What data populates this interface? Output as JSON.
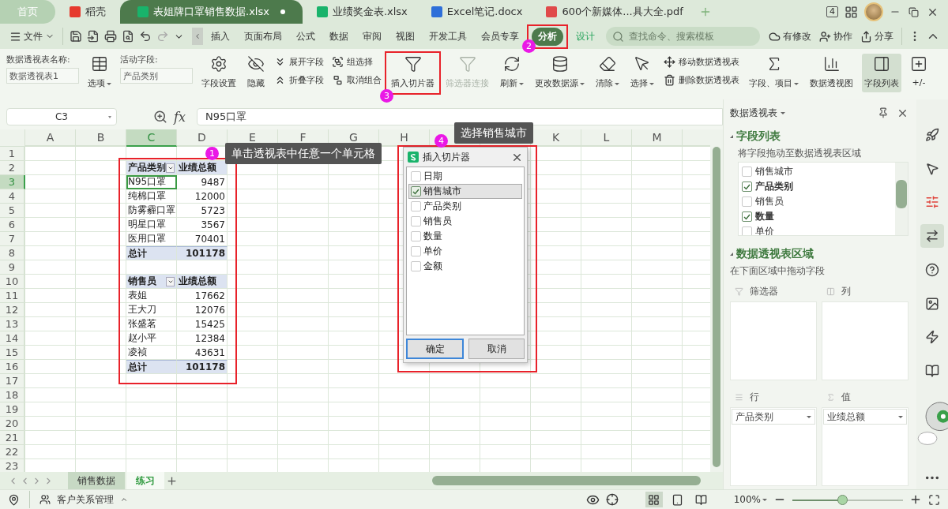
{
  "app_tabs": [
    {
      "label": "首页",
      "kind": "home",
      "selected": false
    },
    {
      "label": "稻壳",
      "kind": "docer",
      "selected": false
    },
    {
      "label": "表姐牌口罩销售数据.xlsx",
      "kind": "sheet",
      "selected": true
    },
    {
      "label": "业绩奖金表.xlsx",
      "kind": "sheet",
      "selected": false
    },
    {
      "label": "Excel笔记.docx",
      "kind": "doc",
      "selected": false
    },
    {
      "label": "600个新媒体...具大全.pdf",
      "kind": "pdf",
      "selected": false
    }
  ],
  "device_badge": "4",
  "menu": {
    "file": "文件",
    "items": [
      {
        "label": "插入",
        "kind": "normal",
        "selected": false
      },
      {
        "label": "页面布局",
        "kind": "normal",
        "selected": false
      },
      {
        "label": "公式",
        "kind": "normal",
        "selected": false
      },
      {
        "label": "数据",
        "kind": "normal",
        "selected": false
      },
      {
        "label": "审阅",
        "kind": "normal",
        "selected": false
      },
      {
        "label": "视图",
        "kind": "normal",
        "selected": false
      },
      {
        "label": "开发工具",
        "kind": "normal",
        "selected": false
      },
      {
        "label": "会员专享",
        "kind": "normal",
        "selected": false
      },
      {
        "label": "分析",
        "kind": "context",
        "selected": true
      },
      {
        "label": "设计",
        "kind": "context",
        "selected": false
      }
    ],
    "search": {
      "placeholder": "查找命令、搜索模板"
    },
    "actions": [
      "有修改",
      "协作",
      "分享"
    ]
  },
  "ribbon": [
    {
      "kind": "field",
      "label": "数据透视表名称:",
      "value": "数据透视表1"
    },
    {
      "kind": "large",
      "label": "选项",
      "dropdown": true,
      "disabled": false,
      "on": false
    },
    {
      "kind": "field",
      "label": "活动字段:",
      "value": "产品类别"
    },
    {
      "kind": "large",
      "label": "字段设置",
      "dropdown": false,
      "disabled": false,
      "on": false
    },
    {
      "kind": "large",
      "label": "隐藏",
      "dropdown": false,
      "disabled": false,
      "on": false
    },
    {
      "kind": "stack",
      "items": [
        "展开字段",
        "折叠字段"
      ]
    },
    {
      "kind": "stack",
      "items": [
        "组选择",
        "取消组合"
      ]
    },
    {
      "kind": "large",
      "label": "插入切片器",
      "dropdown": false,
      "disabled": false,
      "on": false
    },
    {
      "kind": "large",
      "label": "筛选器连接",
      "dropdown": false,
      "disabled": true,
      "on": false
    },
    {
      "kind": "large",
      "label": "刷新",
      "dropdown": true,
      "disabled": false,
      "on": false
    },
    {
      "kind": "large",
      "label": "更改数据源",
      "dropdown": true,
      "disabled": false,
      "on": false
    },
    {
      "kind": "large",
      "label": "清除",
      "dropdown": true,
      "disabled": false,
      "on": false
    },
    {
      "kind": "large",
      "label": "选择",
      "dropdown": true,
      "disabled": false,
      "on": false
    },
    {
      "kind": "stack",
      "items": [
        "移动数据透视表",
        "删除数据透视表"
      ]
    },
    {
      "kind": "large",
      "label": "字段、项目",
      "dropdown": true,
      "disabled": false,
      "on": false
    },
    {
      "kind": "large",
      "label": "数据透视图",
      "dropdown": false,
      "disabled": false,
      "on": false
    },
    {
      "kind": "large",
      "label": "字段列表",
      "dropdown": false,
      "disabled": false,
      "on": true
    },
    {
      "kind": "large",
      "label": "+/-",
      "dropdown": false,
      "disabled": false,
      "on": false
    }
  ],
  "formula_bar": {
    "name_box": "C3",
    "fx": "fx",
    "value": "N95口罩"
  },
  "grid": {
    "columns": [
      {
        "label": "A",
        "selected": false
      },
      {
        "label": "B",
        "selected": false
      },
      {
        "label": "C",
        "selected": true
      },
      {
        "label": "D",
        "selected": false
      },
      {
        "label": "E",
        "selected": false
      },
      {
        "label": "F",
        "selected": false
      },
      {
        "label": "G",
        "selected": false
      },
      {
        "label": "H",
        "selected": false
      },
      {
        "selected": false
      },
      {
        "selected": false
      },
      {
        "label": "K",
        "selected": false
      },
      {
        "label": "L",
        "selected": false
      },
      {
        "label": "M",
        "selected": false
      }
    ],
    "rows": [
      {
        "label": "1",
        "selected": false
      },
      {
        "label": "2",
        "selected": false
      },
      {
        "label": "3",
        "selected": true
      },
      {
        "label": "4",
        "selected": false
      },
      {
        "label": "5",
        "selected": false
      },
      {
        "label": "6",
        "selected": false
      },
      {
        "label": "7",
        "selected": false
      },
      {
        "label": "8",
        "selected": false
      },
      {
        "label": "9",
        "selected": false
      },
      {
        "label": "10",
        "selected": false
      },
      {
        "label": "11",
        "selected": false
      },
      {
        "label": "12",
        "selected": false
      },
      {
        "label": "13",
        "selected": false
      },
      {
        "label": "14",
        "selected": false
      },
      {
        "label": "15",
        "selected": false
      },
      {
        "label": "16",
        "selected": false
      },
      {
        "label": "17",
        "selected": false
      },
      {
        "label": "18",
        "selected": false
      },
      {
        "label": "19",
        "selected": false
      },
      {
        "label": "20",
        "selected": false
      },
      {
        "label": "21",
        "selected": false
      },
      {
        "label": "22",
        "selected": false
      },
      {
        "label": "23",
        "selected": false
      }
    ]
  },
  "pivots": [
    {
      "header": [
        "产品类别",
        "业绩总额"
      ],
      "rows": [
        {
          "label": "N95口罩",
          "value": "9487",
          "selected": true
        },
        {
          "label": "纯棉口罩",
          "value": "12000",
          "selected": false
        },
        {
          "label": "防雾霾口罩",
          "value": "5723",
          "selected": false
        },
        {
          "label": "明星口罩",
          "value": "3567",
          "selected": false
        },
        {
          "label": "医用口罩",
          "value": "70401",
          "selected": false
        }
      ],
      "total": [
        "总计",
        "101178"
      ]
    },
    {
      "header": [
        "销售员",
        "业绩总额"
      ],
      "rows": [
        {
          "label": "表姐",
          "value": "17662",
          "selected": false
        },
        {
          "label": "王大刀",
          "value": "12076",
          "selected": false
        },
        {
          "label": "张盛茗",
          "value": "15425",
          "selected": false
        },
        {
          "label": "赵小平",
          "value": "12384",
          "selected": false
        },
        {
          "label": "凌祯",
          "value": "43631",
          "selected": false
        }
      ],
      "total": [
        "总计",
        "101178"
      ]
    }
  ],
  "slicer_dialog": {
    "title": "插入切片器",
    "fields": [
      {
        "label": "日期",
        "checked": false,
        "selected": false
      },
      {
        "label": "销售城市",
        "checked": true,
        "selected": true
      },
      {
        "label": "产品类别",
        "checked": false,
        "selected": false
      },
      {
        "label": "销售员",
        "checked": false,
        "selected": false
      },
      {
        "label": "数量",
        "checked": false,
        "selected": false
      },
      {
        "label": "单价",
        "checked": false,
        "selected": false
      },
      {
        "label": "金额",
        "checked": false,
        "selected": false
      }
    ],
    "buttons": [
      {
        "label": "确定",
        "default": true
      },
      {
        "label": "取消",
        "default": false
      }
    ]
  },
  "steps": [
    {
      "number": "1",
      "tip": "单击透视表中任意一个单元格"
    },
    {
      "number": "2"
    },
    {
      "number": "3"
    },
    {
      "number": "4",
      "tip": "选择销售城市"
    }
  ],
  "field_panel": {
    "title": "数据透视表",
    "field_section": "字段列表",
    "field_hint": "将字段拖动至数据透视表区域",
    "fields": [
      {
        "label": "销售城市",
        "checked": false
      },
      {
        "label": "产品类别",
        "checked": true
      },
      {
        "label": "销售员",
        "checked": false
      },
      {
        "label": "数量",
        "checked": true
      },
      {
        "label": "单价",
        "checked": false
      }
    ],
    "area_section": "数据透视表区域",
    "area_hint": "在下面区域中拖动字段",
    "areas": [
      {
        "label": "筛选器",
        "kind": "filter"
      },
      {
        "label": "列",
        "kind": "column"
      },
      {
        "label": "行",
        "kind": "row",
        "items": [
          "产品类别"
        ]
      },
      {
        "label": "值",
        "kind": "value",
        "items": [
          "业绩总额"
        ]
      }
    ]
  },
  "sheets": [
    {
      "label": "销售数据",
      "selected": false
    },
    {
      "label": "练习",
      "selected": true
    }
  ],
  "status": {
    "app": "客户关系管理",
    "zoom": "100%",
    "zoom_slider": {
      "level": 0.45
    },
    "views": [
      {
        "selected": true
      },
      {
        "selected": false
      },
      {
        "selected": false
      }
    ]
  }
}
